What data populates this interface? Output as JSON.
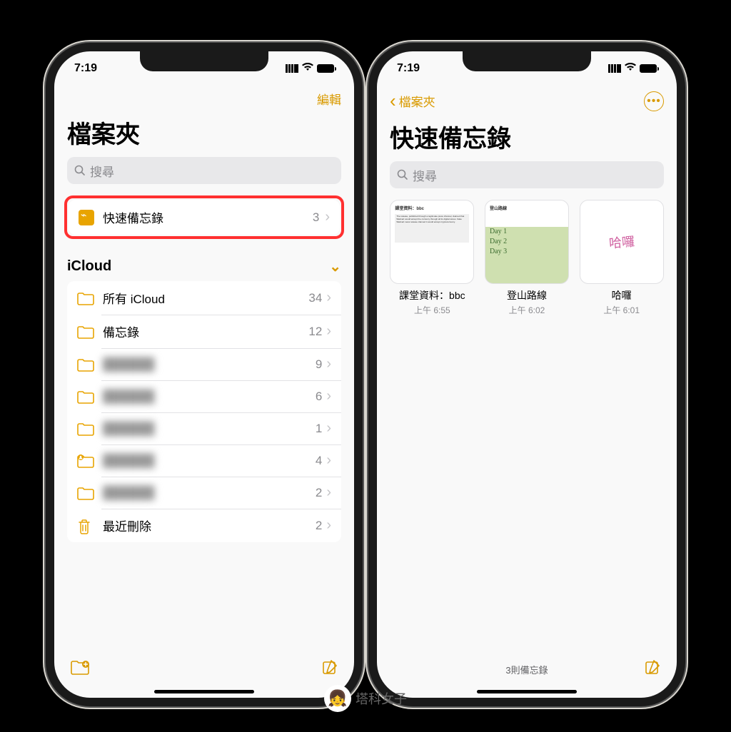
{
  "status": {
    "time": "7:19"
  },
  "left": {
    "edit": "編輯",
    "title": "檔案夾",
    "search_placeholder": "搜尋",
    "quicknote": {
      "label": "快速備忘錄",
      "count": "3"
    },
    "section": "iCloud",
    "folders": [
      {
        "label": "所有 iCloud",
        "count": "34",
        "icon": "folder"
      },
      {
        "label": "備忘錄",
        "count": "12",
        "icon": "folder"
      },
      {
        "label": "██████",
        "count": "9",
        "icon": "folder",
        "blur": true
      },
      {
        "label": "██████",
        "count": "6",
        "icon": "folder",
        "blur": true
      },
      {
        "label": "██████",
        "count": "1",
        "icon": "folder",
        "blur": true
      },
      {
        "label": "██████",
        "count": "4",
        "icon": "shared-folder",
        "blur": true
      },
      {
        "label": "██████",
        "count": "2",
        "icon": "folder",
        "blur": true
      },
      {
        "label": "最近刪除",
        "count": "2",
        "icon": "trash"
      }
    ]
  },
  "right": {
    "back": "檔案夾",
    "title": "快速備忘錄",
    "search_placeholder": "搜尋",
    "notes": [
      {
        "title": "課堂資料：bbc",
        "time": "上午 6:55"
      },
      {
        "title": "登山路線",
        "time": "上午 6:02"
      },
      {
        "title": "哈囉",
        "time": "上午 6:01"
      }
    ],
    "footer": "3則備忘錄"
  },
  "watermark": "塔科女子"
}
